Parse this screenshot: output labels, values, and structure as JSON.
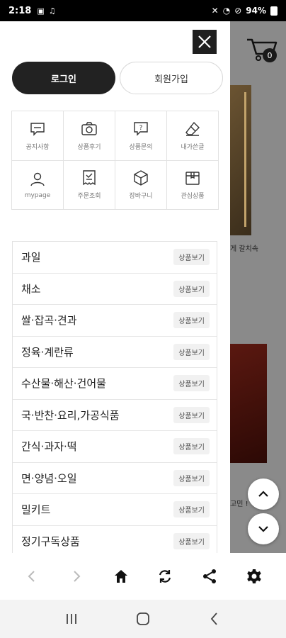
{
  "status_bar": {
    "time": "2:18",
    "battery_percent": "94%"
  },
  "background": {
    "caption_1": "게 갈치속",
    "caption_2": "고민 !",
    "cart_count": "0"
  },
  "drawer": {
    "login_label": "로그인",
    "join_label": "회원가입",
    "quick_menu": [
      {
        "label": "공지사항",
        "icon": "notice-icon"
      },
      {
        "label": "상품후기",
        "icon": "review-camera-icon"
      },
      {
        "label": "상품문의",
        "icon": "question-icon"
      },
      {
        "label": "내가쓴글",
        "icon": "eraser-icon"
      },
      {
        "label": "mypage",
        "icon": "user-icon"
      },
      {
        "label": "주문조회",
        "icon": "receipt-icon"
      },
      {
        "label": "장바구니",
        "icon": "box-icon"
      },
      {
        "label": "관심상품",
        "icon": "gift-box-icon"
      }
    ],
    "categories": [
      {
        "name": "과일",
        "button": "상품보기"
      },
      {
        "name": "채소",
        "button": "상품보기"
      },
      {
        "name": "쌀·잡곡·견과",
        "button": "상품보기"
      },
      {
        "name": "정육·계란류",
        "button": "상품보기"
      },
      {
        "name": "수산물·해산·건어물",
        "button": "상품보기"
      },
      {
        "name": "국·반찬·요리,가공식품",
        "button": "상품보기"
      },
      {
        "name": "간식·과자·떡",
        "button": "상품보기"
      },
      {
        "name": "면·양념·오일",
        "button": "상품보기"
      },
      {
        "name": "밀키트",
        "button": "상품보기"
      },
      {
        "name": "정기구독상품",
        "button": "상품보기"
      }
    ]
  },
  "toolbar": {
    "icons": [
      "back-icon",
      "forward-icon",
      "home-icon",
      "refresh-icon",
      "share-icon",
      "settings-icon"
    ]
  },
  "colors": {
    "dark": "#222222",
    "border": "#e2e2e2",
    "tag_bg": "#f1f1f1"
  }
}
